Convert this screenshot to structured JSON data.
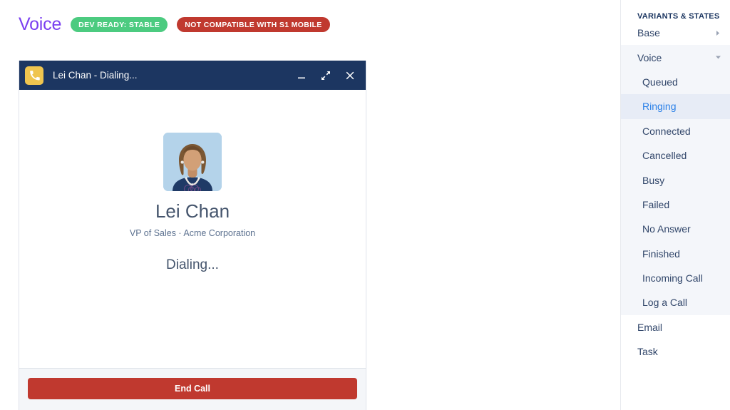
{
  "header": {
    "title": "Voice",
    "badges": [
      {
        "label": "DEV READY: STABLE",
        "color": "#4ccb80"
      },
      {
        "label": "NOT COMPATIBLE WITH S1 MOBILE",
        "color": "#c0392f"
      }
    ]
  },
  "call_window": {
    "app_icon": "phone-icon",
    "title": "Lei Chan - Dialing...",
    "controls": [
      {
        "name": "minimize",
        "icon": "minimize-icon"
      },
      {
        "name": "expand",
        "icon": "expand-icon"
      },
      {
        "name": "close",
        "icon": "close-icon"
      }
    ],
    "avatar": {
      "icon": "user-avatar",
      "background": "#b4d3ea",
      "hair": "#7b5733",
      "skin": "#d2a077",
      "shirt": "#1f3a66"
    },
    "contact_name": "Lei Chan",
    "contact_meta": "VP of Sales  ·  Acme Corporation",
    "status": "Dialing...",
    "end_call_label": "End Call",
    "end_call_color": "#c0392f",
    "titlebar_color": "#1c3661"
  },
  "sidebar": {
    "heading": "VARIANTS & STATES",
    "selected": "Ringing",
    "groups": [
      {
        "label": "Base",
        "expanded": false,
        "chevron": "chevron-right-icon",
        "children": []
      },
      {
        "label": "Voice",
        "expanded": true,
        "chevron": "chevron-down-icon",
        "children": [
          {
            "label": "Queued"
          },
          {
            "label": "Ringing"
          },
          {
            "label": "Connected"
          },
          {
            "label": "Cancelled"
          },
          {
            "label": "Busy"
          },
          {
            "label": "Failed"
          },
          {
            "label": "No Answer"
          },
          {
            "label": "Finished"
          },
          {
            "label": "Incoming Call"
          },
          {
            "label": "Log a Call"
          }
        ]
      },
      {
        "label": "Email",
        "expanded": false,
        "chevron": "",
        "children": []
      },
      {
        "label": "Task",
        "expanded": false,
        "chevron": "",
        "children": []
      }
    ]
  }
}
